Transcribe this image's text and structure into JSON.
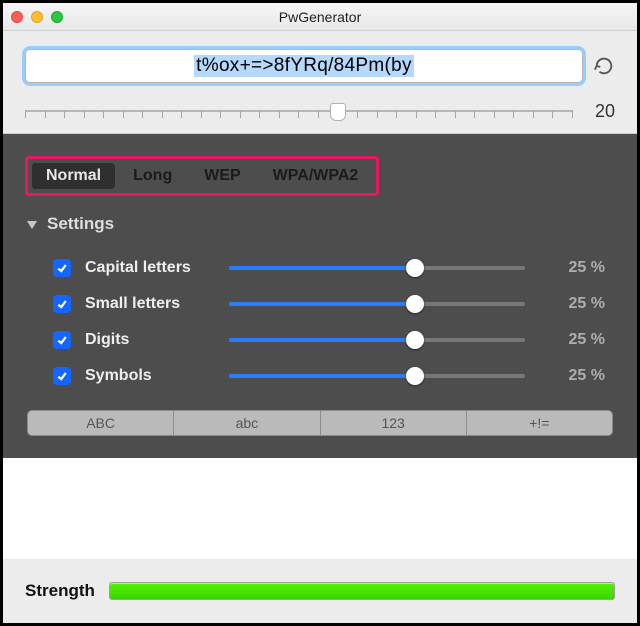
{
  "window": {
    "title": "PwGenerator"
  },
  "password": {
    "value": "t%ox+=>8fYRq/84Pm(by",
    "length": "20"
  },
  "length_slider": {
    "min": 4,
    "max": 32,
    "value": 20
  },
  "tabs": [
    "Normal",
    "Long",
    "WEP",
    "WPA/WPA2"
  ],
  "active_tab": 0,
  "settings_title": "Settings",
  "options": [
    {
      "label": "Capital letters",
      "checked": true,
      "pct": "25 %",
      "fill": 63
    },
    {
      "label": "Small letters",
      "checked": true,
      "pct": "25 %",
      "fill": 63
    },
    {
      "label": "Digits",
      "checked": true,
      "pct": "25 %",
      "fill": 63
    },
    {
      "label": "Symbols",
      "checked": true,
      "pct": "25 %",
      "fill": 63
    }
  ],
  "segments": [
    "ABC",
    "abc",
    "123",
    "+!="
  ],
  "strength": {
    "label": "Strength",
    "percent": 100,
    "color": "#4be700"
  }
}
